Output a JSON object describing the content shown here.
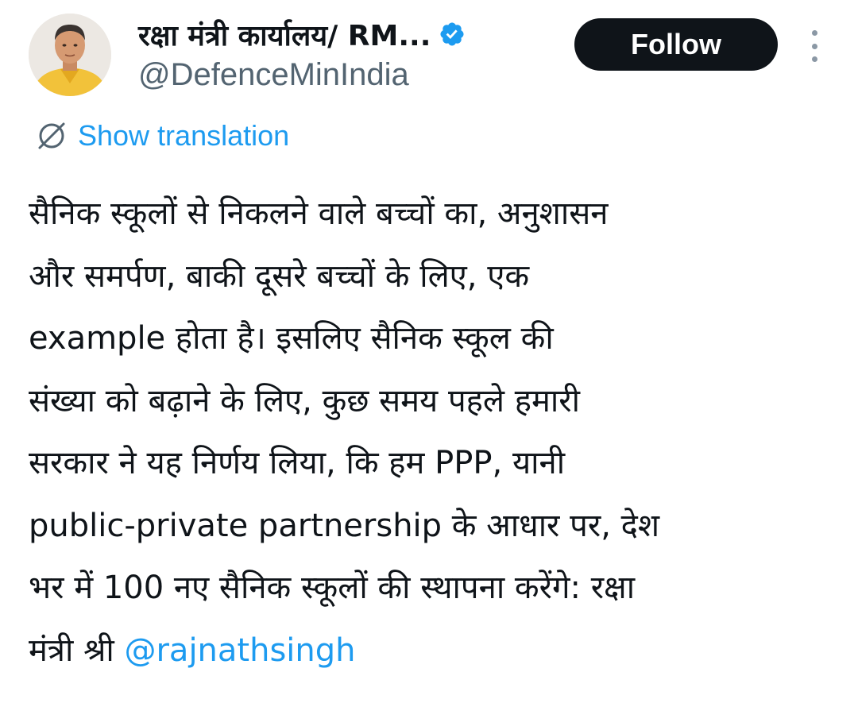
{
  "author": {
    "display_name": "रक्षा मंत्री कार्यालय/ RM...",
    "handle": "@DefenceMinIndia",
    "verified": true
  },
  "actions": {
    "follow_label": "Follow",
    "more_icon": "more-vertical-icon"
  },
  "translation": {
    "icon": "globe-translate-icon",
    "label": "Show translation"
  },
  "tweet": {
    "lines": [
      "सैनिक स्कूलों से निकलने वाले बच्चों का, अनुशासन",
      "और समर्पण, बाकी दूसरे बच्चों के लिए, एक",
      "example होता है। इसलिए सैनिक स्कूल की",
      "संख्या को बढ़ाने के लिए, कुछ समय पहले हमारी",
      "सरकार ने यह निर्णय लिया, कि हम PPP, यानी",
      "public-private partnership के आधार पर, देश",
      "भर में  100 नए सैनिक स्कूलों की स्थापना करेंगे: रक्षा"
    ],
    "last_line_prefix": "मंत्री श्री ",
    "mention": "@rajnathsingh"
  },
  "colors": {
    "accent": "#1d9bf0",
    "text": "#0f1419",
    "secondary": "#536471",
    "follow_bg": "#0f1419"
  }
}
